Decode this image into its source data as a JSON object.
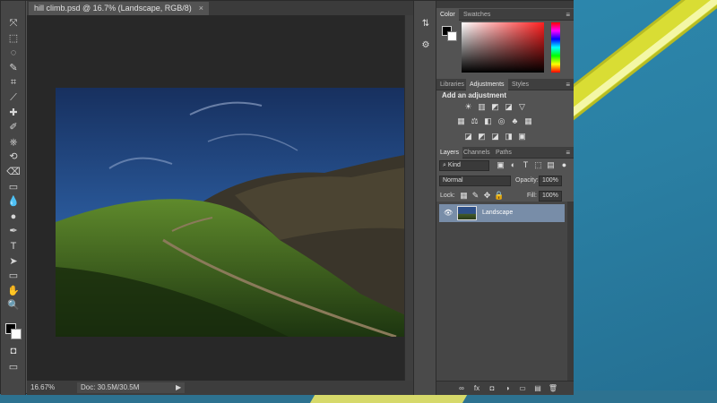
{
  "document": {
    "tab_title": "hill climb.psd @ 16.7% (Landscape, RGB/8)",
    "tab_close": "×"
  },
  "status": {
    "zoom": "16.67%",
    "doc_info": "Doc: 30.5M/30.5M",
    "arrow": "▶"
  },
  "color_panel": {
    "tabs": [
      "Color",
      "Swatches"
    ],
    "menu": "≡"
  },
  "adjustments_panel": {
    "tabs": [
      "Libraries",
      "Adjustments",
      "Styles"
    ],
    "title": "Add an adjustment",
    "row1": [
      "☀",
      "▥",
      "◩",
      "◪",
      "▽"
    ],
    "row2": [
      "▦",
      "⚖",
      "◧",
      "◎",
      "♣",
      "▦"
    ],
    "row3": [
      "◪",
      "◩",
      "◪",
      "◨",
      "▣"
    ]
  },
  "layers_panel": {
    "tabs": [
      "Layers",
      "Channels",
      "Paths"
    ],
    "kind_label": "Kind",
    "blend_mode": "Normal",
    "opacity_label": "Opacity:",
    "opacity_value": "100%",
    "lock_label": "Lock:",
    "fill_label": "Fill:",
    "fill_value": "100%",
    "layers": [
      {
        "name": "Landscape",
        "visible_icon": "👁"
      }
    ],
    "footer_icons": [
      "∞",
      "fx",
      "◘",
      "◑",
      "▭",
      "▤",
      "🗑"
    ]
  },
  "toolbar": {
    "tools": [
      "move-tool",
      "marquee-tool",
      "lasso-tool",
      "quick-select-tool",
      "crop-tool",
      "eyedropper-tool",
      "healing-brush-tool",
      "brush-tool",
      "clone-stamp-tool",
      "history-brush-tool",
      "eraser-tool",
      "gradient-tool",
      "blur-tool",
      "dodge-tool",
      "pen-tool",
      "type-tool",
      "path-select-tool",
      "rectangle-tool",
      "hand-tool",
      "zoom-tool"
    ],
    "glyphs": [
      "⤧",
      "⬚",
      "◌",
      "✎",
      "⌗",
      "⟋",
      "✚",
      "✐",
      "⎈",
      "⟲",
      "⌫",
      "▭",
      "💧",
      "●",
      "✒",
      "T",
      "➤",
      "▭",
      "✋",
      "🔍"
    ]
  },
  "colors": {
    "panel_bg": "#535353",
    "canvas_bg": "#282828",
    "selected_layer": "#788da8",
    "desktop": "#2f8fb6",
    "accent_stripe": "#d9dd34"
  }
}
